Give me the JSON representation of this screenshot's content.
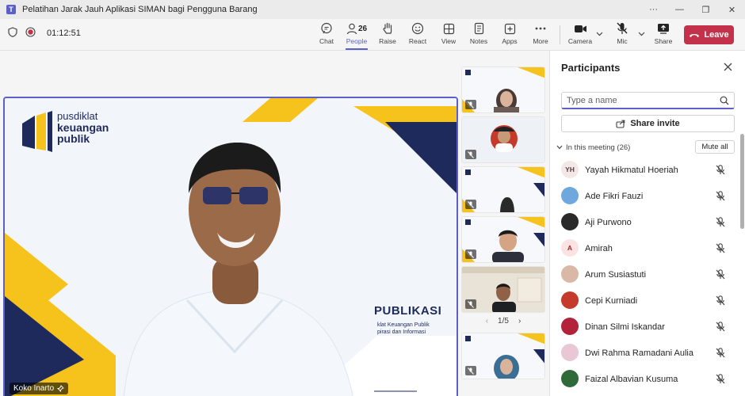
{
  "window": {
    "title": "Pelatihan Jarak Jauh Aplikasi SIMAN bagi Pengguna Barang",
    "app_icon": "T",
    "more_glyph": "···",
    "minimize_glyph": "—",
    "restore_glyph": "❐",
    "close_glyph": "✕"
  },
  "toolbar": {
    "timer": "01:12:51",
    "people_count": "26",
    "chat_label": "Chat",
    "people_label": "People",
    "raise_label": "Raise",
    "react_label": "React",
    "view_label": "View",
    "notes_label": "Notes",
    "apps_label": "Apps",
    "more_label": "More",
    "camera_label": "Camera",
    "mic_label": "Mic",
    "share_label": "Share",
    "leave_label": "Leave",
    "accent": "#5b5fc7",
    "leave_color": "#c4314b"
  },
  "stage": {
    "presenter_name": "Koko Inarto",
    "logo_line1": "pusdiklat",
    "logo_line2": "keuangan",
    "logo_line3": "publik",
    "banner_title": "PUBLIKASI",
    "banner_sub1": "klat Keuangan Publik",
    "banner_sub2": "pirasi dan Informasi",
    "pager_text": "1/5",
    "pager_prev": "‹",
    "pager_next": "›"
  },
  "panel": {
    "title": "Participants",
    "search_placeholder": "Type a name",
    "share_invite": "Share invite",
    "section_label": "In this meeting (26)",
    "mute_all": "Mute all",
    "participants": [
      {
        "name": "Yayah Hikmatul Hoeriah",
        "initials": "YH",
        "avatar_color": "#f3e8e8",
        "avatar_text": "#5c3b3b"
      },
      {
        "name": "Ade Fikri Fauzi",
        "initials": "",
        "avatar_color": "#6fa8dc",
        "avatar_text": "#ffffff"
      },
      {
        "name": "Aji Purwono",
        "initials": "",
        "avatar_color": "#2a2a2a",
        "avatar_text": "#ffffff"
      },
      {
        "name": "Amirah",
        "initials": "A",
        "avatar_color": "#fbe3e3",
        "avatar_text": "#a4262c"
      },
      {
        "name": "Arum Susiastuti",
        "initials": "",
        "avatar_color": "#d9b8a8",
        "avatar_text": "#ffffff"
      },
      {
        "name": "Cepi Kurniadi",
        "initials": "",
        "avatar_color": "#c43b2c",
        "avatar_text": "#ffffff"
      },
      {
        "name": "Dinan Silmi Iskandar",
        "initials": "",
        "avatar_color": "#b2223a",
        "avatar_text": "#ffffff"
      },
      {
        "name": "Dwi Rahma Ramadani Aulia",
        "initials": "",
        "avatar_color": "#e9c7d4",
        "avatar_text": "#ffffff"
      },
      {
        "name": "Faizal Albavian Kusuma",
        "initials": "",
        "avatar_color": "#2f6b3a",
        "avatar_text": "#ffffff"
      }
    ]
  }
}
